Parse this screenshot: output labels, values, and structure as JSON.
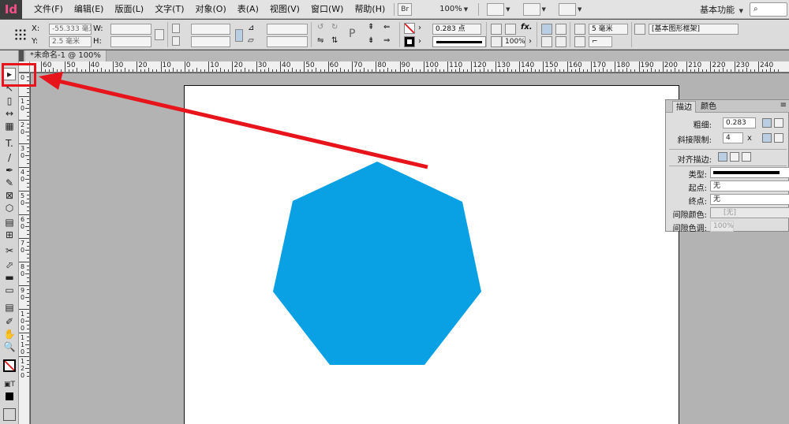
{
  "app": {
    "logo": "Id"
  },
  "menu": {
    "items": [
      "文件(F)",
      "编辑(E)",
      "版面(L)",
      "文字(T)",
      "对象(O)",
      "表(A)",
      "视图(V)",
      "窗口(W)",
      "帮助(H)"
    ],
    "bridge": "Br",
    "zoom": "100%",
    "workspace": "基本功能",
    "search_icon": "search-icon"
  },
  "control": {
    "x_label": "X:",
    "x_value": "-55.333 毫米",
    "y_label": "Y:",
    "y_value": "2.5 毫米",
    "w_label": "W:",
    "h_label": "H:",
    "stroke_weight": "0.283 点",
    "scale": "100%",
    "fit_value": "5 毫米",
    "object_style": "[基本图形框架]",
    "fx_label": "fx."
  },
  "document_tab": {
    "title": "*未命名-1 @ 100%",
    "close": "×"
  },
  "ruler_top": [
    "60",
    "50",
    "40",
    "30",
    "20",
    "10",
    "0",
    "10",
    "20",
    "30",
    "40",
    "50",
    "60",
    "70",
    "80",
    "90",
    "100",
    "110",
    "120",
    "130",
    "140",
    "150",
    "160",
    "170",
    "180",
    "190",
    "200",
    "210",
    "220",
    "230",
    "240"
  ],
  "ruler_left": [
    "0",
    "1 0",
    "2 0",
    "3 0",
    "4 0",
    "5 0",
    "6 0",
    "7 0",
    "8 0",
    "9 0",
    "1 0 0",
    "1 1 0",
    "1 2 0"
  ],
  "tools": [
    "▸",
    "↖",
    "▯",
    "↔",
    "▦",
    "T.",
    "/",
    "✒",
    "✎",
    "⊠",
    "⬡",
    "▤",
    "⊞",
    "✂",
    "⬀",
    "▬",
    "▭",
    "▤",
    "✐",
    "✋",
    "🔍"
  ],
  "shape": {
    "fill": "#0aa0e4",
    "type": "heptagon"
  },
  "annotation": {
    "color": "#e8141c"
  },
  "stroke_panel": {
    "tab_stroke": "描边",
    "tab_color": "颜色",
    "weight_label": "粗细:",
    "weight_value": "0.283",
    "miter_label": "斜接限制:",
    "miter_value": "4",
    "miter_unit": "x",
    "align_label": "对齐描边:",
    "type_label": "类型:",
    "start_label": "起点:",
    "start_value": "无",
    "end_label": "终点:",
    "end_value": "无",
    "gap_color_label": "间隙颜色:",
    "gap_color_value": "[无]",
    "gap_tint_label": "间隙色调:",
    "gap_tint_value": "100%"
  }
}
